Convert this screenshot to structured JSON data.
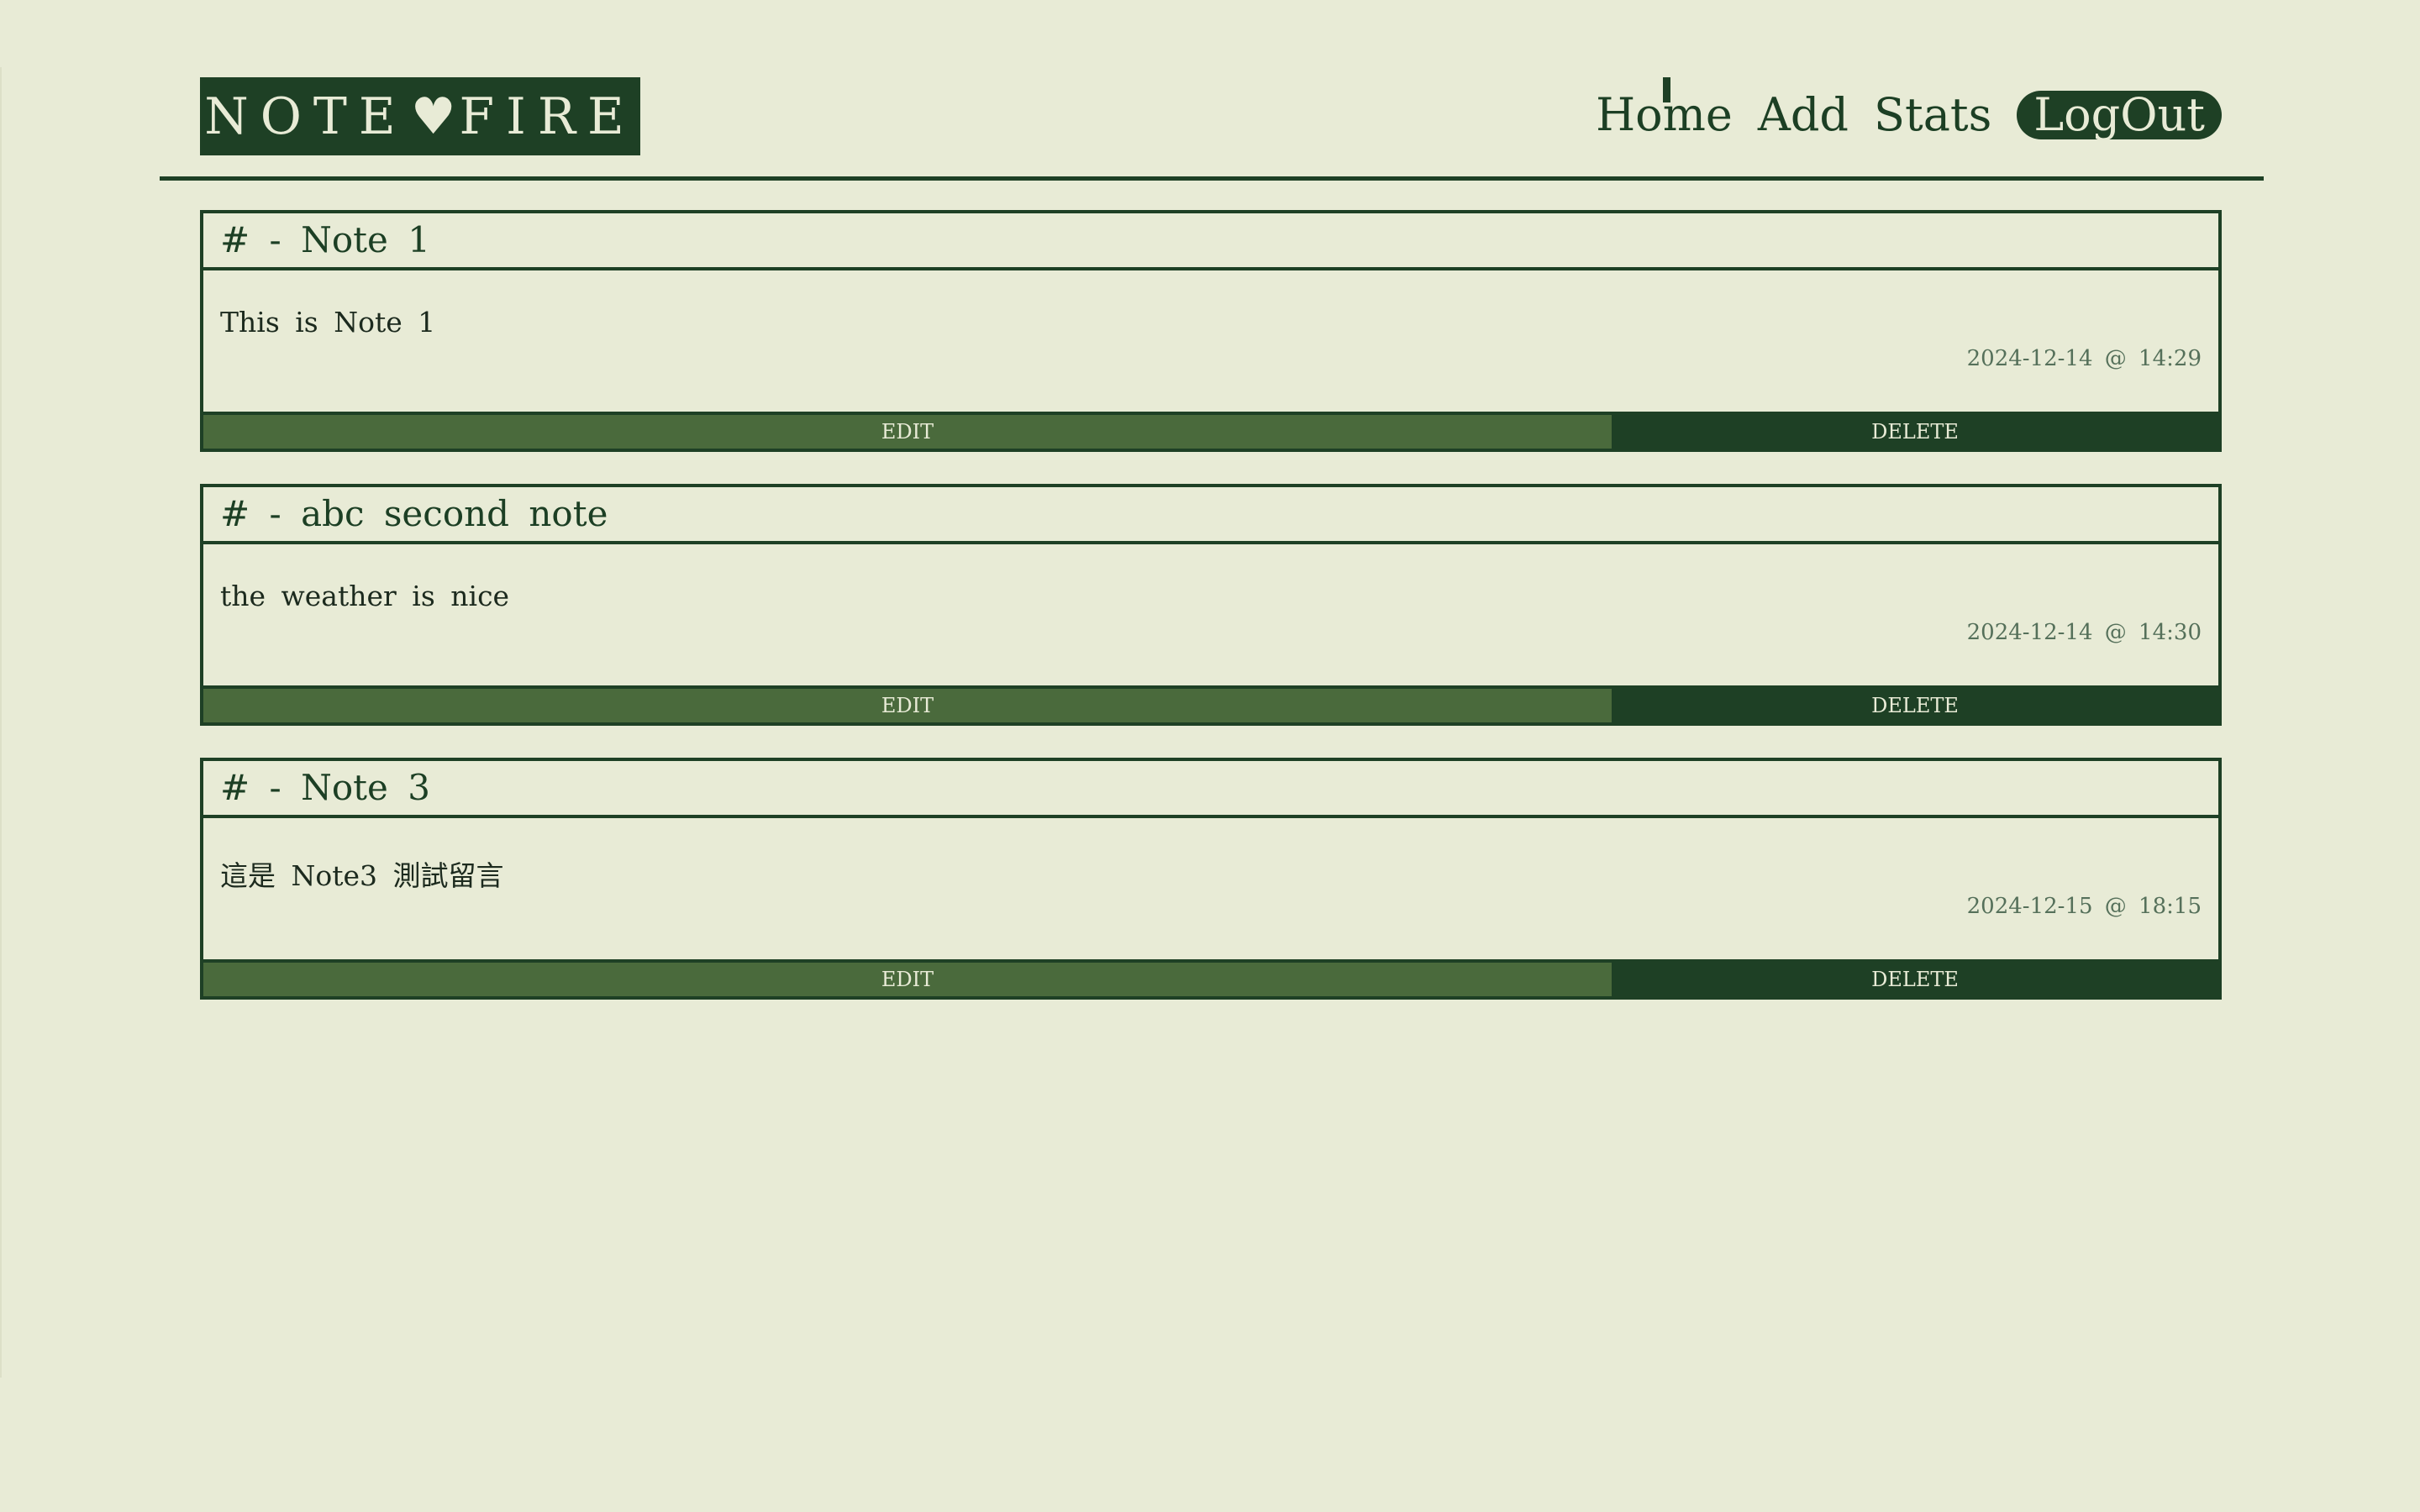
{
  "logo": {
    "left": "NOTE",
    "heart": "♥",
    "right": "FIRE"
  },
  "nav": {
    "home": "Home",
    "add": "Add",
    "stats": "Stats",
    "logout": "LogOut"
  },
  "notes": [
    {
      "title": "# - Note 1",
      "content": "This is Note 1",
      "timestamp": "2024-12-14 @ 14:29",
      "edit_label": "EDIT",
      "delete_label": "DELETE"
    },
    {
      "title": "# - abc second note",
      "content": "the weather is nice",
      "timestamp": "2024-12-14 @ 14:30",
      "edit_label": "EDIT",
      "delete_label": "DELETE"
    },
    {
      "title": "# - Note 3",
      "content": "這是 Note3 測試留言",
      "timestamp": "2024-12-15 @ 18:15",
      "edit_label": "EDIT",
      "delete_label": "DELETE"
    }
  ],
  "colors": {
    "background": "#e8ebd6",
    "primary": "#1e4025",
    "edit_button": "#4a6a3c",
    "timestamp": "#55705a"
  }
}
